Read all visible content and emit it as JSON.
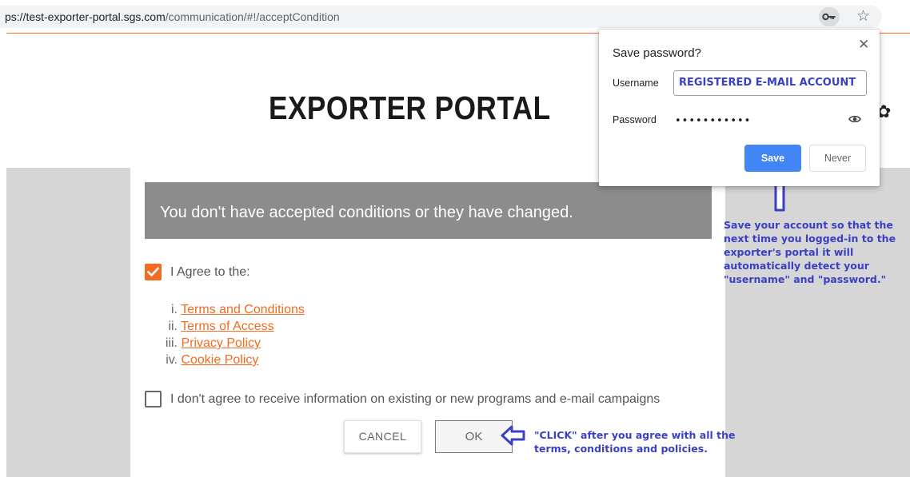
{
  "browser": {
    "url_host": "ps://test-exporter-portal.sgs.com",
    "url_path": "/communication/#!/acceptCondition",
    "icons": [
      "key-icon",
      "star-icon"
    ]
  },
  "page": {
    "title": "EXPORTER PORTAL",
    "notice": "You don't have accepted conditions or they have changed.",
    "agree_label": "I Agree to the:",
    "agree_checked": true,
    "terms": [
      {
        "num": "i.",
        "label": "Terms and Conditions"
      },
      {
        "num": "ii.",
        "label": "Terms of Access"
      },
      {
        "num": "iii.",
        "label": "Privacy Policy"
      },
      {
        "num": "iv.",
        "label": "Cookie Policy"
      }
    ],
    "disagree_label": "I don't agree to receive information on existing or new programs and e-mail campaigns",
    "disagree_checked": false,
    "cancel_label": "CANCEL",
    "ok_label": "OK",
    "accent_color": "#f26b21"
  },
  "popup": {
    "title": "Save password?",
    "close": "✕",
    "username_label": "Username",
    "username_value": "REGISTERED E-MAIL ACCOUNT",
    "password_label": "Password",
    "password_value": "•••••••••••",
    "save_label": "Save",
    "never_label": "Never"
  },
  "annotations": {
    "save_note": [
      "Save your account so that the",
      "next time you logged-in to the",
      "exporter's portal it will",
      "automatically detect your",
      "\"username\" and \"password.\""
    ],
    "click_note": [
      "\"CLICK\" after you agree with all the",
      "terms, conditions and policies."
    ],
    "annotation_color": "#3a3fc4"
  }
}
